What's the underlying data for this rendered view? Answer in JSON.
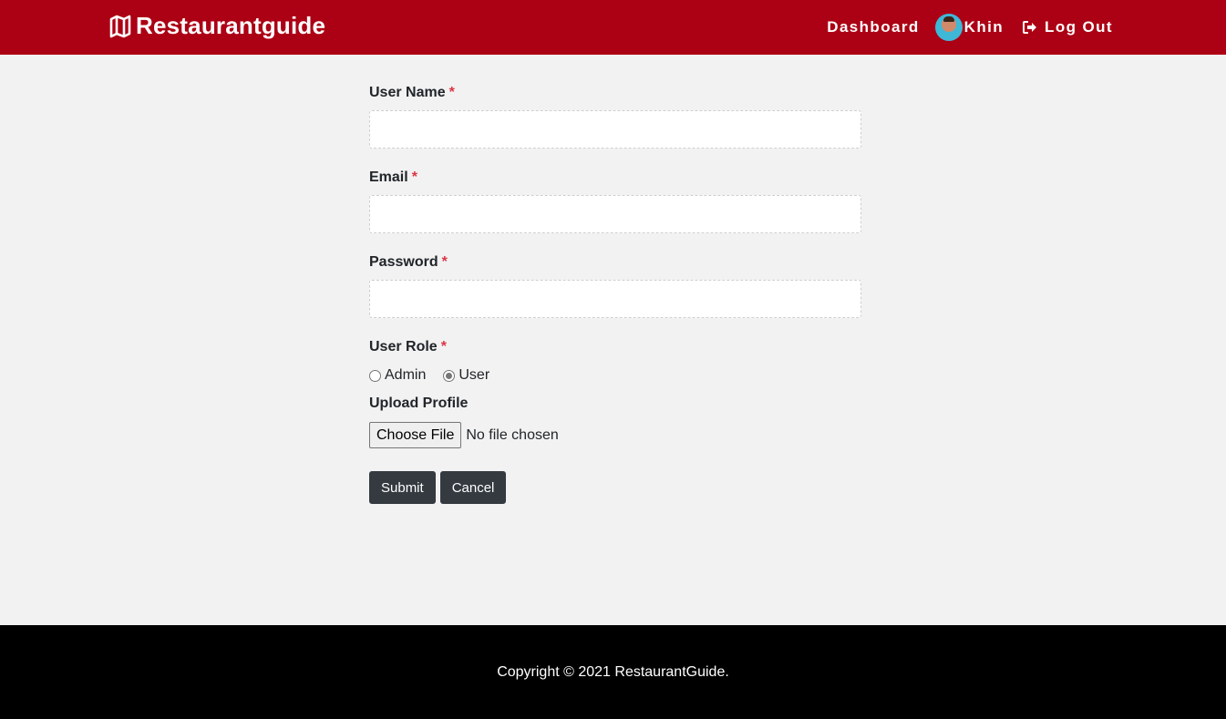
{
  "navbar": {
    "brand": "Restaurantguide",
    "brand_icon": "map-icon",
    "dashboard_label": "Dashboard",
    "user_name": "Khin",
    "logout_label": "Log Out",
    "logout_icon": "sign-out-icon",
    "bg_color": "#ac0014"
  },
  "form": {
    "username": {
      "label": "User Name",
      "required_mark": "*",
      "value": ""
    },
    "email": {
      "label": "Email",
      "required_mark": "*",
      "value": ""
    },
    "password": {
      "label": "Password",
      "required_mark": "*",
      "value": ""
    },
    "role": {
      "label": "User Role",
      "required_mark": "*",
      "options": [
        {
          "label": "Admin",
          "checked": false
        },
        {
          "label": "User",
          "checked": true
        }
      ]
    },
    "upload": {
      "label": "Upload Profile",
      "button_label": "Choose File",
      "status": "No file chosen"
    },
    "submit_label": "Submit",
    "cancel_label": "Cancel"
  },
  "footer": {
    "text": "Copyright © 2021 RestaurantGuide."
  }
}
